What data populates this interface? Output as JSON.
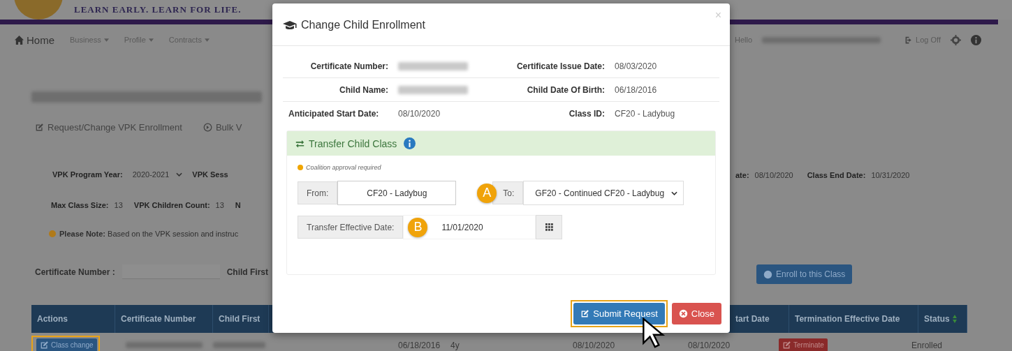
{
  "header": {
    "tagline": "LEARN EARLY. LEARN FOR LIFE."
  },
  "nav": {
    "home": "Home",
    "menus": [
      "Business",
      "Profile",
      "Contracts"
    ],
    "greeting": "Hello",
    "logoff": "Log Off"
  },
  "page": {
    "links": [
      {
        "label": "Request/Change VPK Enrollment",
        "kind": "edit"
      },
      {
        "label": "Bulk V",
        "kind": "circle"
      }
    ],
    "program_year": {
      "label": "VPK Program Year:",
      "value": "2020-2021"
    },
    "session_label": "VPK Sess",
    "start_date": {
      "label": "ate:",
      "value": "08/10/2020"
    },
    "end_date": {
      "label": "Class End Date:",
      "value": "10/31/2020"
    },
    "max_class_size": {
      "label": "Max Class Size:",
      "value": "13"
    },
    "children_count": {
      "label": "VPK Children Count:",
      "value": "13"
    },
    "cut_label": "N",
    "note": "**Please Note:** Based on the VPK session and instruc",
    "search": {
      "certificate_label": "Certificate Number :",
      "child_label": "Child First"
    },
    "enroll_button": "Enroll to this Class"
  },
  "table": {
    "left_columns": [
      "Actions",
      "Certificate Number",
      "Child First"
    ],
    "right_columns": [
      "tart Date",
      "Termination Effective Date",
      "Status"
    ],
    "row": {
      "action": "Class change",
      "action_highlighted": true,
      "birth_date": "06/18/2016",
      "age": "4y",
      "start_date": "08/10/2020",
      "enrollment_date": "08/10/2020",
      "terminate": "Terminate",
      "status": "Enrolled"
    }
  },
  "modal": {
    "title": "Change Child Enrollment",
    "close": "×",
    "info": [
      {
        "label": "Certificate Number:",
        "kind": "blurred"
      },
      {
        "label": "Certificate Issue Date:",
        "value": "08/03/2020",
        "kind": "text"
      },
      {
        "label": "Child Name:",
        "kind": "blurred"
      },
      {
        "label": "Child Date Of Birth:",
        "value": "06/18/2016",
        "kind": "text"
      },
      {
        "label": "Anticipated Start Date:",
        "value": "08/10/2020",
        "kind": "text"
      },
      {
        "label": "Class ID:",
        "value": "CF20 - Ladybug",
        "kind": "text"
      }
    ],
    "panel_title": "Transfer Child Class",
    "note": "Coalition approval required",
    "from": {
      "label": "From:",
      "value": "CF20 - Ladybug"
    },
    "marker_a": "A",
    "to": {
      "label": "To:",
      "value": "GF20 - Continued CF20 - Ladybug"
    },
    "date": {
      "label": "Transfer Effective Date:",
      "value": "11/01/2020"
    },
    "marker_b": "B",
    "submit": {
      "label": "Submit Request",
      "highlighted": true
    },
    "close_button": "Close"
  }
}
